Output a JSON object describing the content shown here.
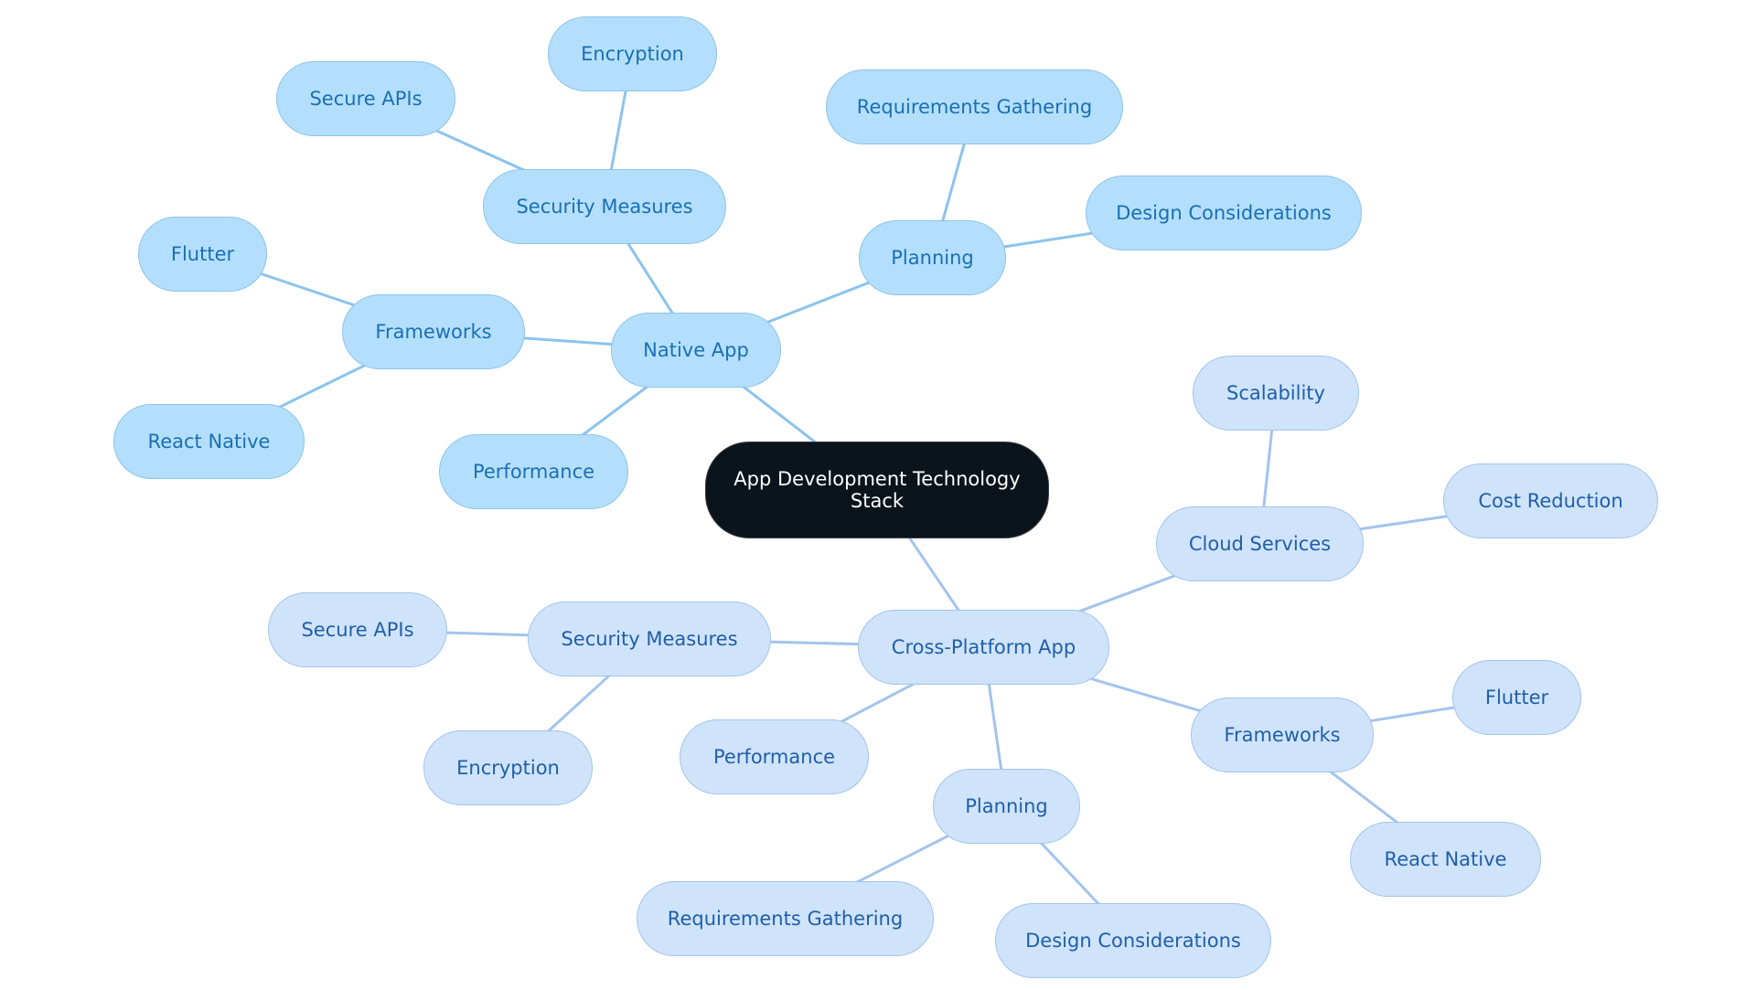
{
  "diagram": {
    "type": "mind-map",
    "colors": {
      "root_fill": "#0b131b",
      "native_fill": "#b3dffc",
      "native_text": "#1a6fb3",
      "cross_fill": "#cfe3fb",
      "cross_text": "#1f5fa8",
      "native_edge": "#8cc3ec",
      "cross_edge": "#a3c4ec"
    },
    "root": "App Development Technology Stack",
    "nodes": {
      "root": "App Development Technology Stack",
      "native": "Native App",
      "n_security": "Security Measures",
      "n_encryption": "Encryption",
      "n_secure_apis": "Secure APIs",
      "n_frameworks": "Frameworks",
      "n_flutter": "Flutter",
      "n_react_native": "React Native",
      "n_performance": "Performance",
      "n_planning": "Planning",
      "n_requirements": "Requirements Gathering",
      "n_design": "Design Considerations",
      "cross": "Cross-Platform App",
      "c_cloud": "Cloud Services",
      "c_scalability": "Scalability",
      "c_cost": "Cost Reduction",
      "c_security": "Security Measures",
      "c_secure_apis": "Secure APIs",
      "c_encryption": "Encryption",
      "c_performance": "Performance",
      "c_planning": "Planning",
      "c_requirements": "Requirements Gathering",
      "c_design": "Design Considerations",
      "c_frameworks": "Frameworks",
      "c_flutter": "Flutter",
      "c_react_native": "React Native"
    },
    "edges": [
      [
        "root",
        "native"
      ],
      [
        "native",
        "n_security"
      ],
      [
        "n_security",
        "n_encryption"
      ],
      [
        "n_security",
        "n_secure_apis"
      ],
      [
        "native",
        "n_frameworks"
      ],
      [
        "n_frameworks",
        "n_flutter"
      ],
      [
        "n_frameworks",
        "n_react_native"
      ],
      [
        "native",
        "n_performance"
      ],
      [
        "native",
        "n_planning"
      ],
      [
        "n_planning",
        "n_requirements"
      ],
      [
        "n_planning",
        "n_design"
      ],
      [
        "root",
        "cross"
      ],
      [
        "cross",
        "c_cloud"
      ],
      [
        "c_cloud",
        "c_scalability"
      ],
      [
        "c_cloud",
        "c_cost"
      ],
      [
        "cross",
        "c_security"
      ],
      [
        "c_security",
        "c_secure_apis"
      ],
      [
        "c_security",
        "c_encryption"
      ],
      [
        "cross",
        "c_performance"
      ],
      [
        "cross",
        "c_planning"
      ],
      [
        "c_planning",
        "c_requirements"
      ],
      [
        "c_planning",
        "c_design"
      ],
      [
        "cross",
        "c_frameworks"
      ],
      [
        "c_frameworks",
        "c_flutter"
      ],
      [
        "c_frameworks",
        "c_react_native"
      ]
    ]
  }
}
